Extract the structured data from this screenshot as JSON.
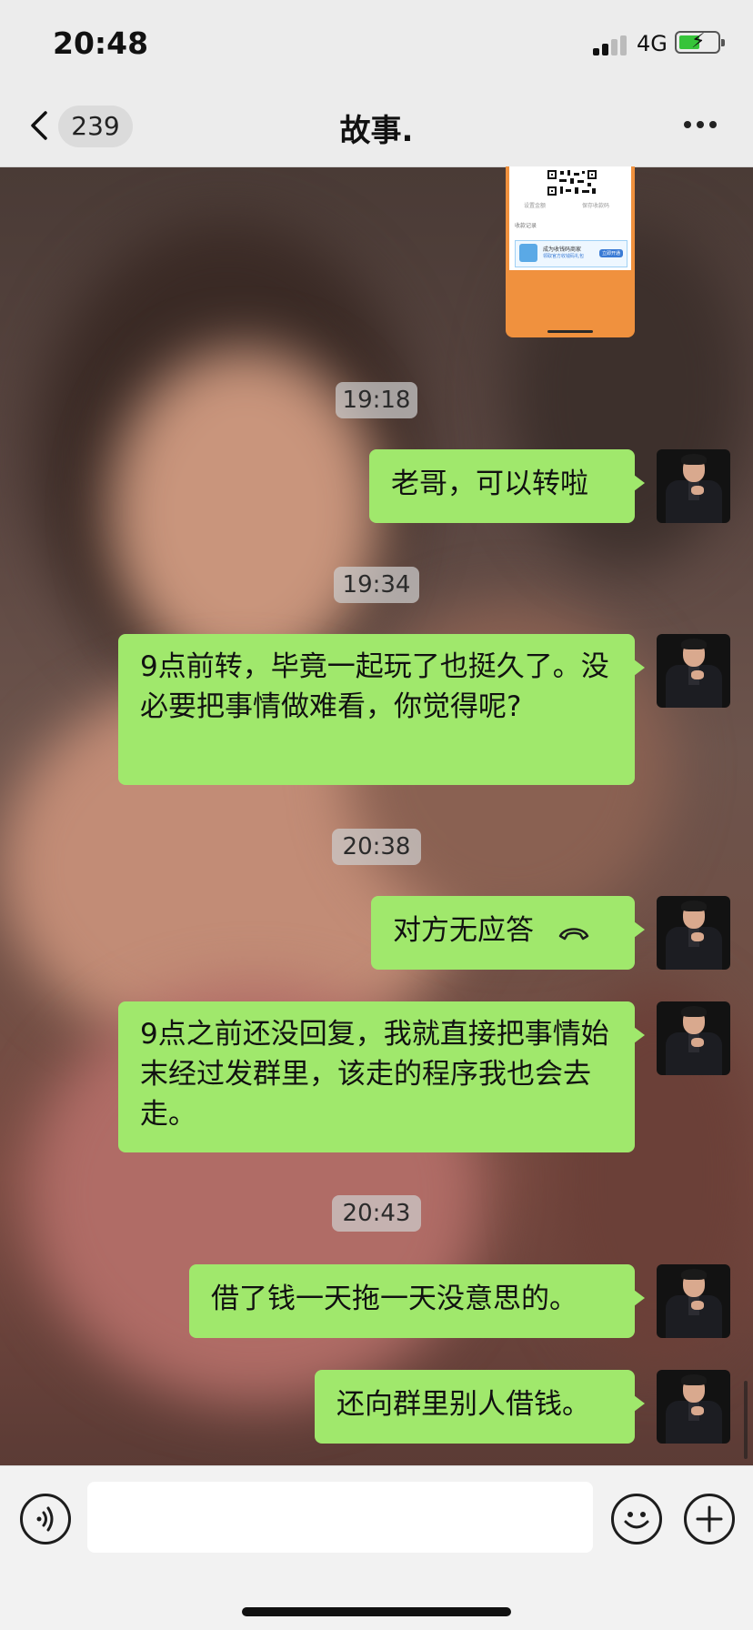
{
  "status_bar": {
    "time": "20:48",
    "network": "4G"
  },
  "header": {
    "unread_count": "239",
    "title": "故事."
  },
  "image_card": {
    "label_left": "设置金额",
    "label_right": "保存收款码",
    "records": "收款记录",
    "promo_title": "成为收钱码商家",
    "promo_sub": "领取官方收钱码礼包",
    "promo_button": "立即开通"
  },
  "messages": [
    {
      "type": "timestamp",
      "text": "19:18"
    },
    {
      "type": "bubble",
      "text": "老哥，可以转啦"
    },
    {
      "type": "timestamp",
      "text": "19:34"
    },
    {
      "type": "bubble",
      "text": "9点前转，毕竟一起玩了也挺久了。没必要把事情做难看，你觉得呢?"
    },
    {
      "type": "timestamp",
      "text": "20:38"
    },
    {
      "type": "call",
      "text": "对方无应答"
    },
    {
      "type": "bubble",
      "text": "9点之前还没回复，我就直接把事情始末经过发群里，该走的程序我也会去走。"
    },
    {
      "type": "timestamp",
      "text": "20:43"
    },
    {
      "type": "bubble",
      "text": "借了钱一天拖一天没意思的。"
    },
    {
      "type": "bubble",
      "text": "还向群里别人借钱。"
    }
  ],
  "colors": {
    "bubble": "#a0e86c",
    "bar": "#ececec",
    "battery": "#36c43a"
  },
  "icons": [
    "back-chevron-icon",
    "more-dots-icon",
    "voice-icon",
    "emoji-icon",
    "plus-icon",
    "hang-up-icon"
  ]
}
